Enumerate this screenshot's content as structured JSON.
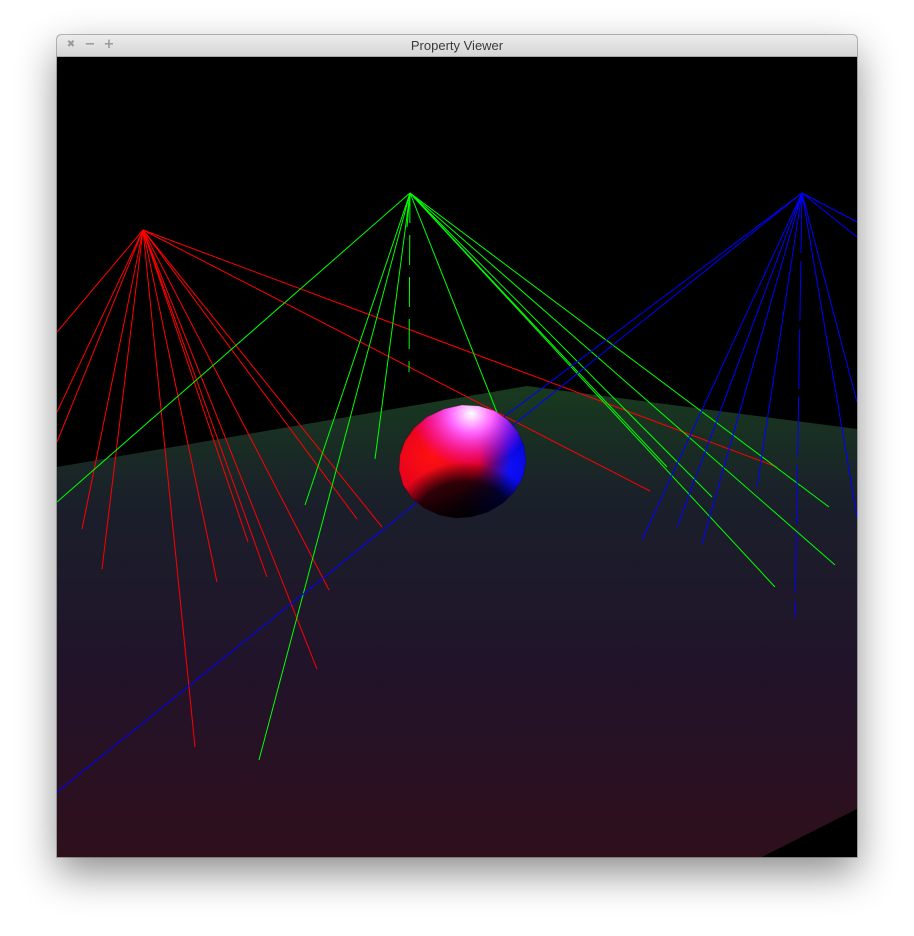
{
  "window": {
    "title": "Property Viewer",
    "controls": {
      "close_icon": "close-icon",
      "minimize_icon": "minimize-icon",
      "maximize_icon": "maximize-icon"
    }
  },
  "scene": {
    "background": "#000000",
    "light_colors": {
      "red": "#ff0000",
      "green": "#00ff00",
      "blue": "#0000ff"
    },
    "plane_colors": {
      "far": "#1a3a1a",
      "near": "#2d0f18"
    }
  }
}
